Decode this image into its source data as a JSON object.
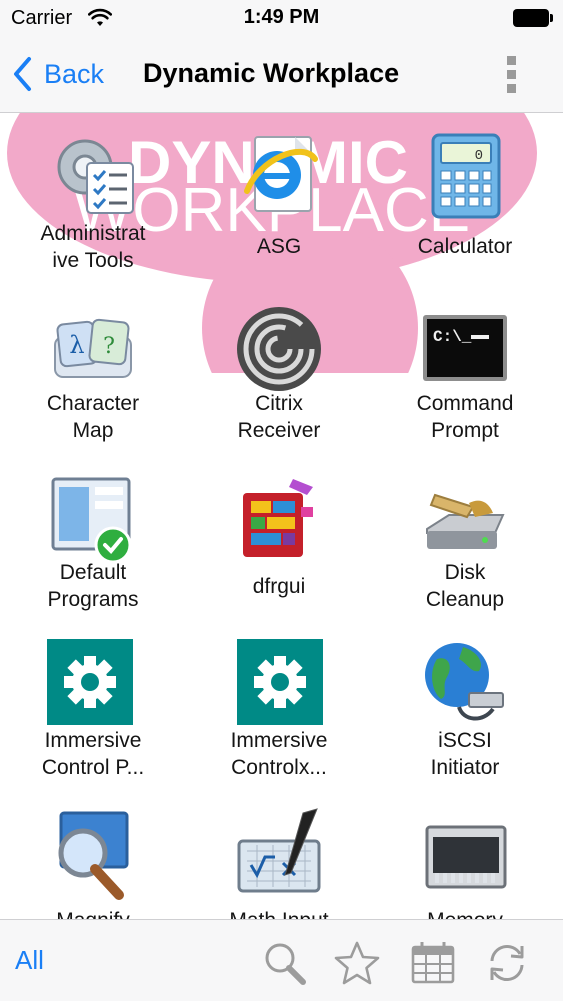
{
  "status_bar": {
    "carrier": "Carrier",
    "time": "1:49 PM"
  },
  "nav": {
    "back_label": "Back",
    "title": "Dynamic Workplace"
  },
  "banner": {
    "line1": "DYNAMIC",
    "line2": "WORKPLACE",
    "color": "#f2a9c9"
  },
  "apps": [
    {
      "label": "Administrat\nive Tools",
      "icon": "administrative-tools-icon"
    },
    {
      "label": "ASG",
      "icon": "asg-icon"
    },
    {
      "label": "Calculator",
      "icon": "calculator-icon"
    },
    {
      "label": "Character\nMap",
      "icon": "character-map-icon"
    },
    {
      "label": "Citrix\nReceiver",
      "icon": "citrix-receiver-icon"
    },
    {
      "label": "Command\nPrompt",
      "icon": "command-prompt-icon"
    },
    {
      "label": "Default\nPrograms",
      "icon": "default-programs-icon"
    },
    {
      "label": "dfrgui",
      "icon": "dfrgui-icon"
    },
    {
      "label": "Disk\nCleanup",
      "icon": "disk-cleanup-icon"
    },
    {
      "label": "Immersive\nControl P...",
      "icon": "immersive-control-panel-icon"
    },
    {
      "label": "Immersive\nControlx...",
      "icon": "immersive-controlx-icon"
    },
    {
      "label": "iSCSI\nInitiator",
      "icon": "iscsi-initiator-icon"
    },
    {
      "label": "Magnify",
      "icon": "magnify-icon"
    },
    {
      "label": "Math Input",
      "icon": "math-input-icon"
    },
    {
      "label": "Memory",
      "icon": "memory-icon"
    }
  ],
  "tab_bar": {
    "all_label": "All",
    "icons": [
      "search-icon",
      "star-icon",
      "calendar-icon",
      "refresh-icon"
    ]
  },
  "colors": {
    "accent": "#1a7ff5",
    "immersive_teal": "#008a86"
  }
}
